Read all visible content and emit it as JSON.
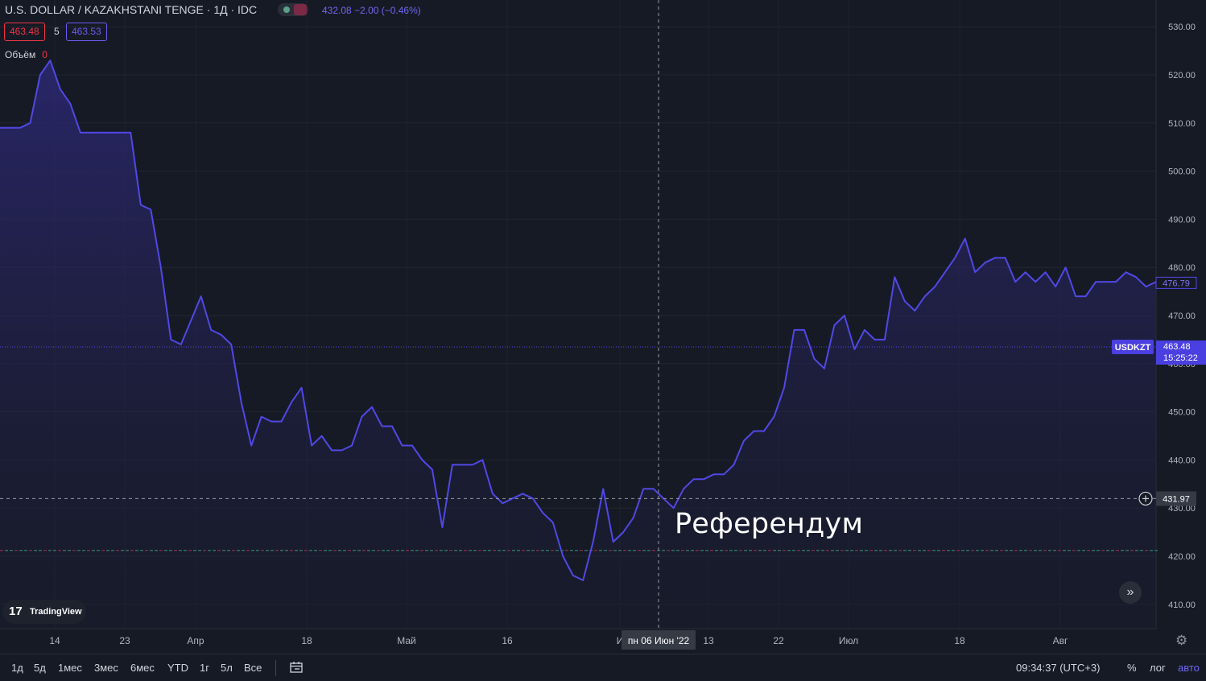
{
  "header": {
    "symbol_title": "U.S. DOLLAR / KAZAKHSTANI TENGE · 1Д · IDC",
    "last_price": "432.08",
    "change": "−2.00 (−0.46%)",
    "bid": "463.48",
    "spread": "5",
    "ask": "463.53",
    "volume_label": "Объём",
    "volume_value": "0"
  },
  "annotation": "Референдум",
  "logo_text": "TradingView",
  "bottom_toolbar": {
    "timeframes": [
      "1д",
      "5д",
      "1мес",
      "3мес",
      "6мес",
      "YTD",
      "1г",
      "5л",
      "Все"
    ],
    "clock": "09:34:37 (UTC+3)",
    "percent": "%",
    "log": "лог",
    "auto": "авто"
  },
  "colors": {
    "background": "#161a25",
    "line": "#5048e5",
    "axis_text": "#b2b5be",
    "crosshair": "#9598a1",
    "price_label": "#4a3fe0",
    "bid": "#f23645"
  },
  "chart_data": {
    "type": "area",
    "title": "U.S. DOLLAR / KAZAKHSTANI TENGE",
    "xlabel": "",
    "ylabel": "",
    "ylim": [
      405,
      535
    ],
    "yticks": [
      410,
      420,
      430,
      440,
      450,
      460,
      470,
      480,
      490,
      500,
      510,
      520,
      530
    ],
    "xtick_labels": [
      "14",
      "23",
      "Апр",
      "18",
      "Май",
      "16",
      "И",
      "13",
      "22",
      "Июл",
      "18",
      "Авг"
    ],
    "crosshair_label": "пн 06 Июн '22",
    "crosshair_price": "431.97",
    "last_value_label": "476.79",
    "symbol_label": "USDKZT",
    "current_price": "463.48",
    "countdown": "15:25:22",
    "grid": true,
    "series": [
      {
        "values": [
          509,
          509,
          509,
          510,
          520,
          523,
          517,
          514,
          508,
          508,
          508,
          508,
          508,
          508,
          493,
          492,
          480,
          465,
          464,
          469,
          474,
          467,
          466,
          464,
          452,
          443,
          449,
          448,
          448,
          452,
          455,
          443,
          445,
          442,
          442,
          443,
          449,
          451,
          447,
          447,
          443,
          443,
          440,
          438,
          426,
          439,
          439,
          439,
          440,
          433,
          431,
          432,
          433,
          432,
          429,
          427,
          420,
          416,
          415,
          423,
          434,
          423,
          425,
          428,
          434,
          434,
          432,
          430,
          434,
          436,
          436,
          437,
          437,
          439,
          444,
          446,
          446,
          449,
          455,
          467,
          467,
          461,
          459,
          468,
          470,
          463,
          467,
          465,
          465,
          478,
          473,
          471,
          474,
          476,
          479,
          482,
          486,
          479,
          481,
          482,
          482,
          477,
          479,
          477,
          479,
          476,
          480,
          474,
          474,
          477,
          477,
          477,
          479,
          478,
          476,
          477
        ]
      }
    ]
  }
}
